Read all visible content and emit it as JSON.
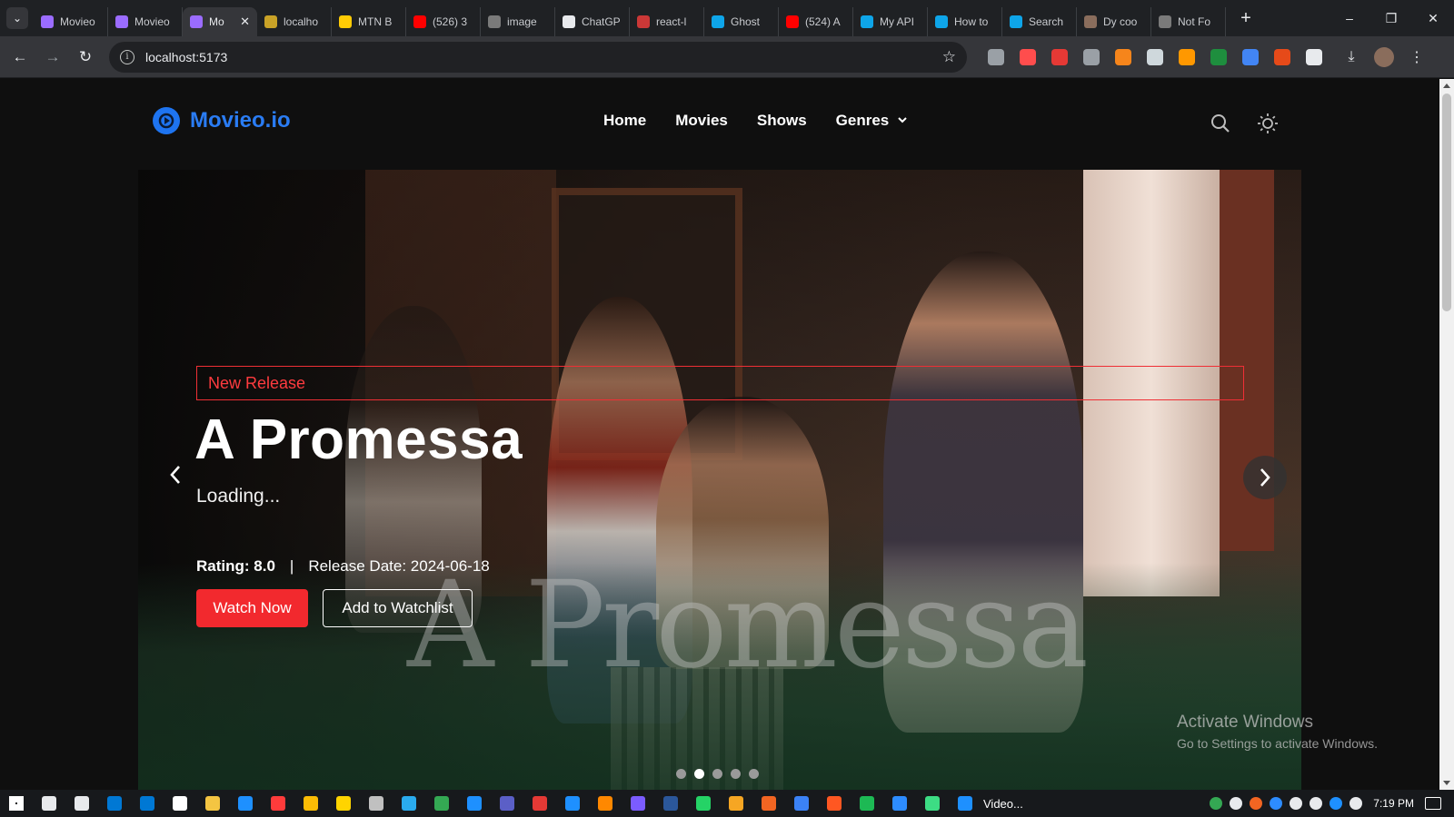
{
  "browser": {
    "tabs": [
      {
        "title": "Movieo",
        "favicon_color": "#9b6cff",
        "active": false
      },
      {
        "title": "Movieo",
        "favicon_color": "#9b6cff",
        "active": false
      },
      {
        "title": "Mo",
        "favicon_color": "#9b6cff",
        "active": true
      },
      {
        "title": "localho",
        "favicon_color": "#c9a227",
        "active": false
      },
      {
        "title": "MTN B",
        "favicon_color": "#ffcb05",
        "active": false
      },
      {
        "title": "(526) 3",
        "favicon_color": "#ff0000",
        "active": false
      },
      {
        "title": "image",
        "favicon_color": "#7a7a7a",
        "active": false
      },
      {
        "title": "ChatGP",
        "favicon_color": "#e8eaed",
        "active": false
      },
      {
        "title": "react-l",
        "favicon_color": "#cb3837",
        "active": false
      },
      {
        "title": "Ghost",
        "favicon_color": "#0ea5e9",
        "active": false
      },
      {
        "title": "(524) A",
        "favicon_color": "#ff0000",
        "active": false
      },
      {
        "title": "My API",
        "favicon_color": "#0ea5e9",
        "active": false
      },
      {
        "title": "How to",
        "favicon_color": "#0ea5e9",
        "active": false
      },
      {
        "title": "Search",
        "favicon_color": "#0ea5e9",
        "active": false
      },
      {
        "title": "Dy coo",
        "favicon_color": "#8a6d5c",
        "active": false
      },
      {
        "title": "Not Fo",
        "favicon_color": "#7a7a7a",
        "active": false
      }
    ],
    "tab_close_icon": "✕",
    "new_tab_icon": "+",
    "window_controls": {
      "minimize": "–",
      "restore": "❐",
      "close": "✕"
    },
    "url": "localhost:5173",
    "extension_colors": [
      "#9aa0a6",
      "#ff4d4d",
      "#e53935",
      "#9aa0a6",
      "#f6851b",
      "#cfd8dc",
      "#ff9800",
      "#1e8e3e",
      "#4285f4",
      "#e64a19",
      "#e8eaed"
    ]
  },
  "site": {
    "logo_text": "Movieo.io",
    "brand_color": "#1e74f0",
    "nav": {
      "home": "Home",
      "movies": "Movies",
      "shows": "Shows",
      "genres": "Genres"
    },
    "icons": {
      "search": "search-icon",
      "theme": "sun-icon"
    },
    "hero": {
      "badge": "New Release",
      "title": "A Promessa",
      "background_title": "A Promessa",
      "overview": "Loading...",
      "rating": "Rating: 8.0",
      "separator": "|",
      "release_date": "Release Date: 2024-06-18",
      "watch_button": "Watch Now",
      "watchlist_button": "Add to Watchlist",
      "accent_color": "#f2292e",
      "slides_total": 5,
      "active_slide": 2
    }
  },
  "windows_watermark": {
    "line1": "Activate Windows",
    "line2": "Go to Settings to activate Windows."
  },
  "taskbar": {
    "app_colors": [
      "#ffffff",
      "#e8eaed",
      "#e8eaed",
      "#0078d4",
      "#0078d4",
      "#ffffff",
      "#f4c542",
      "#1e90ff",
      "#ff3b3b",
      "#fbbc05",
      "#ffd400",
      "#c0c0c0",
      "#2aabee",
      "#34a853",
      "#1e90ff",
      "#5b5fc7",
      "#e53935",
      "#1e90ff",
      "#ff8800",
      "#7b5cff",
      "#2b579a",
      "#25d366",
      "#f6a623",
      "#f26522",
      "#3b82f6",
      "#ff5722",
      "#1db954",
      "#2d8cff",
      "#3ddc84",
      "#1e90ff"
    ],
    "video_label": "Video...",
    "time": "7:19 PM"
  }
}
